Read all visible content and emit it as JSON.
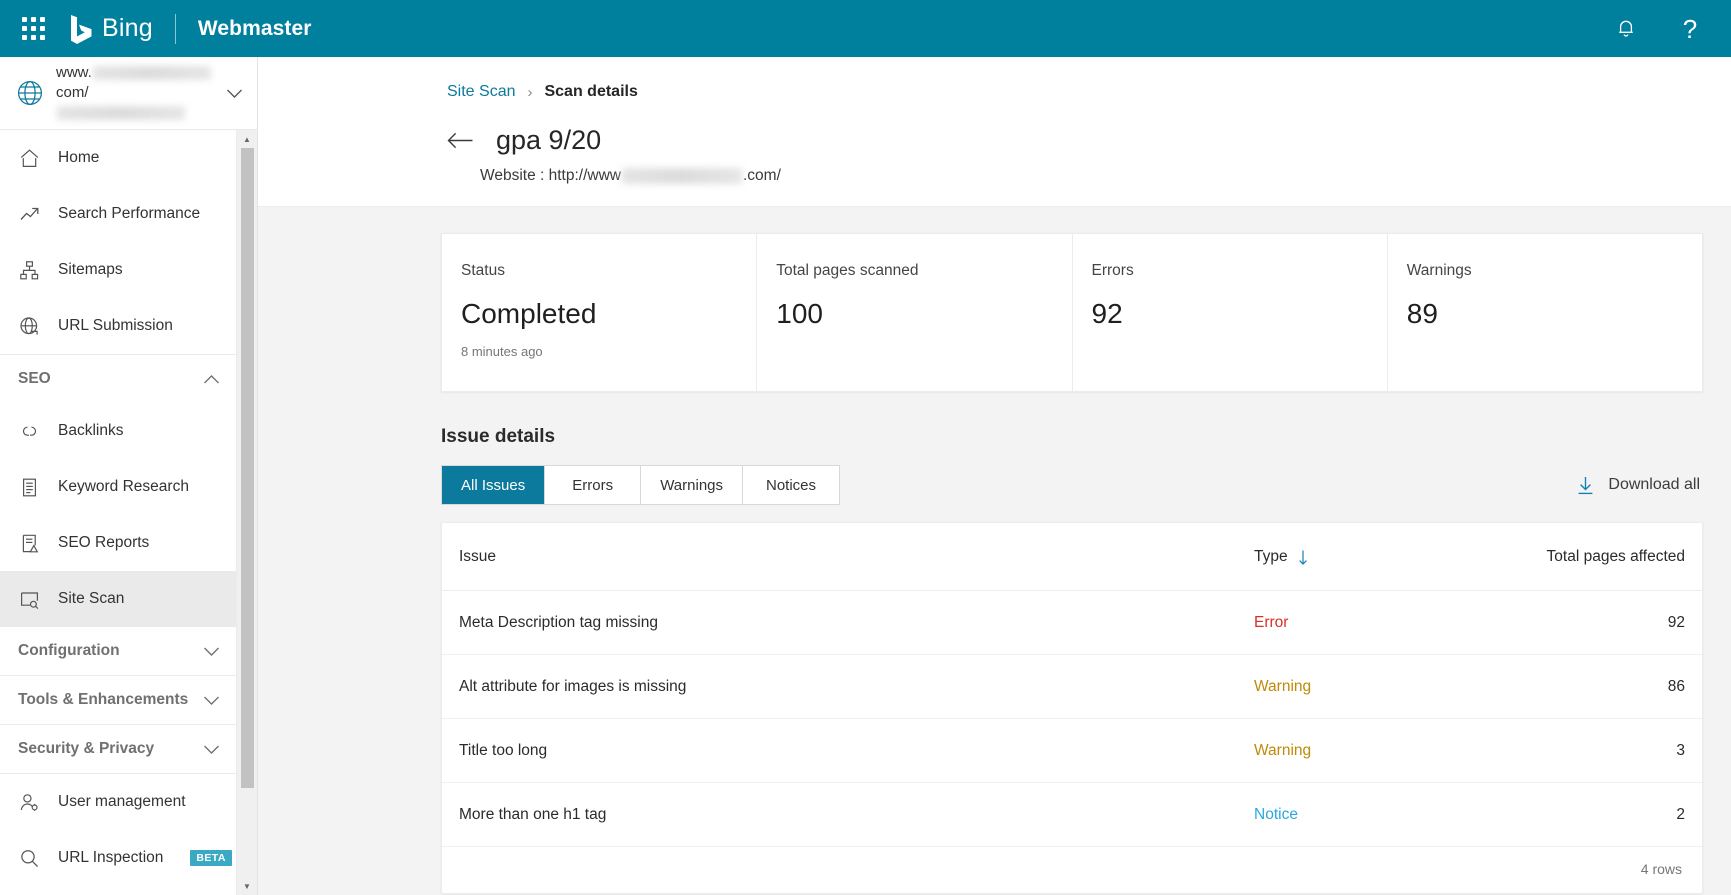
{
  "header": {
    "waffle_label": "app-launcher",
    "brand": "Bing",
    "product": "Webmaster",
    "notifications_label": "Notifications",
    "help_label": "?"
  },
  "sidebar": {
    "site_picker": {
      "prefix": "www.",
      "suffix": "com/",
      "icon": "globe-icon",
      "chevron": "chevron-down-icon"
    },
    "items": [
      {
        "label": "Home",
        "icon": "home-icon",
        "active": false
      },
      {
        "label": "Search Performance",
        "icon": "trending-up-icon",
        "active": false
      },
      {
        "label": "Sitemaps",
        "icon": "sitemap-icon",
        "active": false
      },
      {
        "label": "URL Submission",
        "icon": "globe-upload-icon",
        "active": false
      }
    ],
    "seo_group": {
      "label": "SEO",
      "chevron": "chevron-up-icon",
      "expanded": true
    },
    "seo_items": [
      {
        "label": "Backlinks",
        "icon": "link-chain-icon",
        "active": false
      },
      {
        "label": "Keyword Research",
        "icon": "document-list-icon",
        "active": false
      },
      {
        "label": "SEO Reports",
        "icon": "report-warning-icon",
        "active": false
      },
      {
        "label": "Site Scan",
        "icon": "scan-search-icon",
        "active": true
      }
    ],
    "collapsed_groups": [
      {
        "label": "Configuration",
        "chevron": "chevron-down-icon"
      },
      {
        "label": "Tools & Enhancements",
        "chevron": "chevron-down-icon"
      },
      {
        "label": "Security & Privacy",
        "chevron": "chevron-down-icon"
      }
    ],
    "bottom_items": [
      {
        "label": "User management",
        "icon": "user-settings-icon",
        "badge": ""
      },
      {
        "label": "URL Inspection",
        "icon": "magnifier-icon",
        "badge": "BETA"
      }
    ]
  },
  "breadcrumb": {
    "parent": "Site Scan",
    "separator": "›",
    "current": "Scan details"
  },
  "page": {
    "back_icon": "arrow-left-icon",
    "title": "gpa 9/20",
    "website_label": "Website : http://www",
    "website_tld": ".com/"
  },
  "cards": [
    {
      "label": "Status",
      "value": "Completed",
      "sub": "8 minutes ago"
    },
    {
      "label": "Total pages scanned",
      "value": "100",
      "sub": ""
    },
    {
      "label": "Errors",
      "value": "92",
      "sub": ""
    },
    {
      "label": "Warnings",
      "value": "89",
      "sub": ""
    }
  ],
  "issue_details": {
    "heading": "Issue details",
    "tabs": [
      {
        "label": "All Issues",
        "active": true
      },
      {
        "label": "Errors",
        "active": false
      },
      {
        "label": "Warnings",
        "active": false
      },
      {
        "label": "Notices",
        "active": false
      }
    ],
    "download_label": "Download all",
    "download_icon": "download-icon",
    "columns": [
      "Issue",
      "Type",
      "Total pages affected"
    ],
    "sort_icon": "arrow-down-icon",
    "rows": [
      {
        "issue": "Meta Description tag missing",
        "type": "Error",
        "type_kind": "error",
        "pages": "92"
      },
      {
        "issue": "Alt attribute for images is missing",
        "type": "Warning",
        "type_kind": "warning",
        "pages": "86"
      },
      {
        "issue": "Title too long",
        "type": "Warning",
        "type_kind": "warning",
        "pages": "3"
      },
      {
        "issue": "More than one h1 tag",
        "type": "Notice",
        "type_kind": "notice",
        "pages": "2"
      }
    ],
    "footer": "4 rows"
  },
  "colors": {
    "brand_teal": "#00809d",
    "accent_link": "#0c7a9c",
    "error": "#d93025",
    "warning": "#c08a07",
    "notice": "#2aa8dd",
    "active_tab": "#0c7a9c",
    "beta_badge": "#3aa9c4"
  }
}
